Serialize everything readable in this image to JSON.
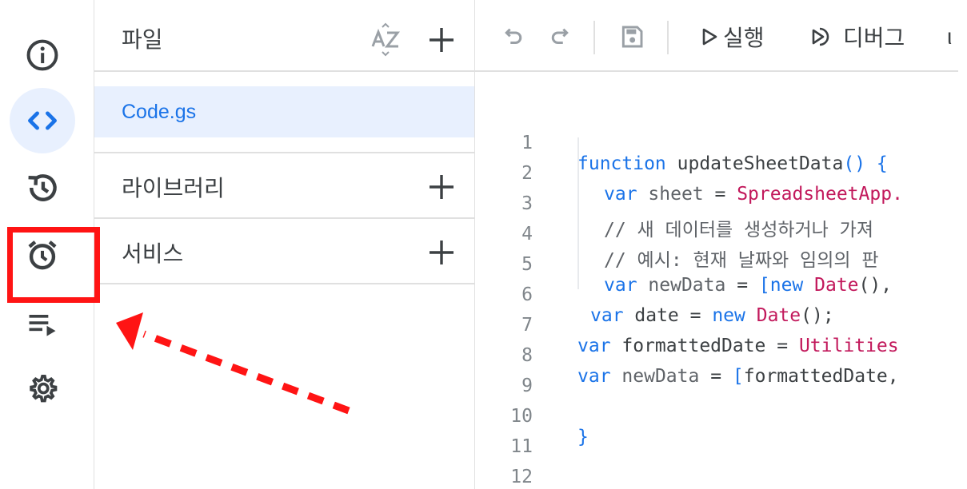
{
  "files_panel": {
    "title": "파일",
    "sort_icon": "sort-az-icon",
    "file_name": "Code.gs",
    "sections": [
      {
        "label": "라이브러리"
      },
      {
        "label": "서비스"
      }
    ]
  },
  "rail": {
    "items": [
      {
        "icon": "info-icon"
      },
      {
        "icon": "code-icon",
        "active": true
      },
      {
        "icon": "history-icon"
      },
      {
        "icon": "alarm-clock-icon"
      },
      {
        "icon": "executions-icon"
      },
      {
        "icon": "gear-icon"
      }
    ]
  },
  "toolbar": {
    "run_label": "실행",
    "debug_label": "디버그",
    "cut_label": "ι"
  },
  "code": {
    "line_numbers": [
      "1",
      "2",
      "3",
      "4",
      "5",
      "6",
      "7",
      "8",
      "9",
      "10",
      "11",
      "12"
    ]
  },
  "colors": {
    "accent": "#1a73e8",
    "active_bg": "#e8f0fe",
    "annotation": "#ff1414"
  }
}
